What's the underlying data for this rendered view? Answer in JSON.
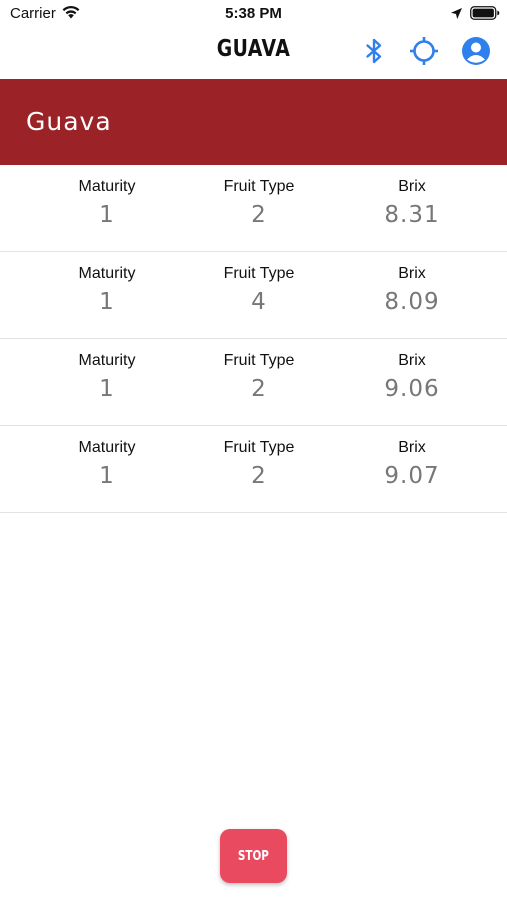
{
  "status_bar": {
    "carrier": "Carrier",
    "time": "5:38 PM",
    "icons": [
      "wifi-icon",
      "location-arrow-icon",
      "battery-icon"
    ]
  },
  "nav": {
    "title": "GUAVA",
    "icons": [
      "bluetooth-icon",
      "crosshair-icon",
      "account-icon"
    ],
    "icon_color": "#2f80ed"
  },
  "banner": {
    "title": "Guava",
    "color": "#9b2226"
  },
  "readings": [
    {
      "maturity_label": "Maturity",
      "maturity": "1",
      "fruit_type_label": "Fruit Type",
      "fruit_type": "2",
      "brix_label": "Brix",
      "brix": "8.31"
    },
    {
      "maturity_label": "Maturity",
      "maturity": "1",
      "fruit_type_label": "Fruit Type",
      "fruit_type": "4",
      "brix_label": "Brix",
      "brix": "8.09"
    },
    {
      "maturity_label": "Maturity",
      "maturity": "1",
      "fruit_type_label": "Fruit Type",
      "fruit_type": "2",
      "brix_label": "Brix",
      "brix": "9.06"
    },
    {
      "maturity_label": "Maturity",
      "maturity": "1",
      "fruit_type_label": "Fruit Type",
      "fruit_type": "2",
      "brix_label": "Brix",
      "brix": "9.07"
    }
  ],
  "stop_button": {
    "label": "STOP",
    "color": "#e94a5f"
  }
}
